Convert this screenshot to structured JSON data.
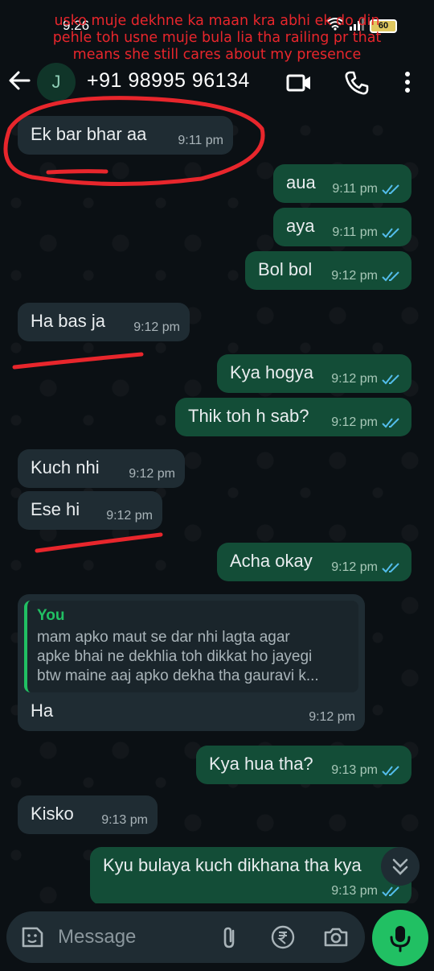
{
  "status": {
    "time": "9:26",
    "battery": "60"
  },
  "annotation": {
    "line1": "usko muje dekhne ka maan kra abhi ek do din",
    "line2": "pehle toh usne muje bula lia tha railing pr that",
    "line3": "means she still cares about my presence"
  },
  "header": {
    "avatar_letter": "J",
    "contact": "+91 98995 96134"
  },
  "messages": [
    {
      "dir": "in",
      "text": "Ek bar bhar aa",
      "time": "9:11 pm"
    },
    {
      "dir": "out",
      "text": "aua",
      "time": "9:11 pm"
    },
    {
      "dir": "out",
      "text": "aya",
      "time": "9:11 pm"
    },
    {
      "dir": "out",
      "text": "Bol bol",
      "time": "9:12 pm"
    },
    {
      "dir": "in",
      "text": "Ha bas ja",
      "time": "9:12 pm"
    },
    {
      "dir": "out",
      "text": "Kya hogya",
      "time": "9:12 pm"
    },
    {
      "dir": "out",
      "text": "Thik toh h sab?",
      "time": "9:12 pm"
    },
    {
      "dir": "in",
      "text": "Kuch nhi",
      "time": "9:12 pm"
    },
    {
      "dir": "in",
      "text": "Ese hi",
      "time": "9:12 pm"
    },
    {
      "dir": "out",
      "text": "Acha okay",
      "time": "9:12 pm"
    },
    {
      "dir": "in",
      "text": "Ha",
      "time": "9:12 pm",
      "quote": {
        "author": "You",
        "line1": "mam apko maut se dar nhi lagta agar",
        "line2": "apke bhai ne dekhlia toh dikkat ho jayegi",
        "line3": "btw maine aaj apko dekha tha gauravi k..."
      }
    },
    {
      "dir": "out",
      "text": "Kya hua tha?",
      "time": "9:13 pm"
    },
    {
      "dir": "in",
      "text": "Kisko",
      "time": "9:13 pm"
    },
    {
      "dir": "out",
      "text": "Kyu bulaya kuch dikhana tha kya",
      "time": "9:13 pm"
    }
  ],
  "input": {
    "placeholder": "Message"
  },
  "icons": {
    "back": "arrow-left-icon",
    "video": "video-call-icon",
    "call": "phone-icon",
    "menu": "more-vert-icon",
    "emoji": "sticker-icon",
    "attach": "paperclip-icon",
    "pay": "rupee-icon",
    "camera": "camera-icon",
    "mic": "mic-icon",
    "scroll": "chevron-double-down-icon"
  },
  "colors": {
    "accent": "#21c063",
    "outgoing": "#134d37",
    "incoming": "#1f2c33",
    "annotation": "#e8262c"
  }
}
